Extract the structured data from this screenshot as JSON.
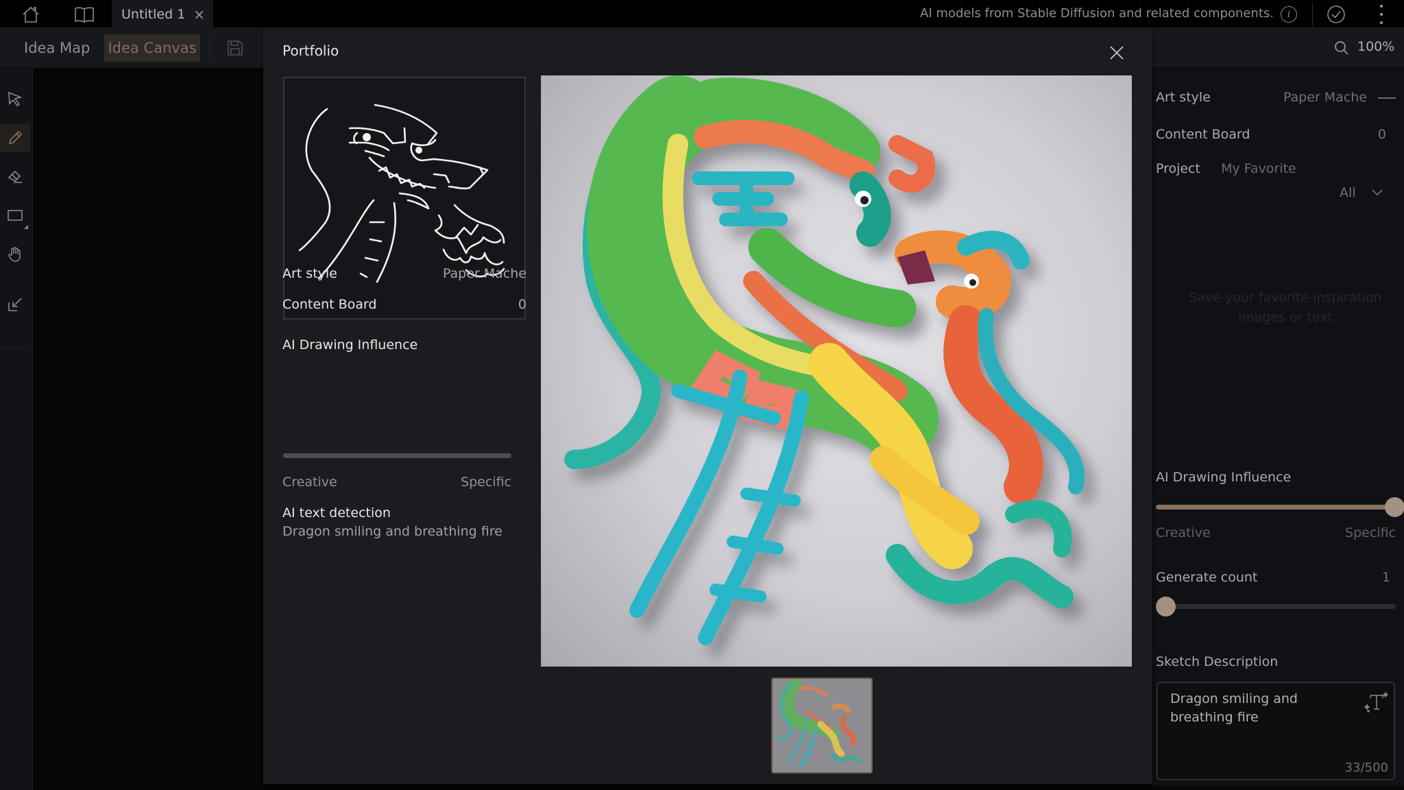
{
  "titlebar": {
    "home_icon": "home-icon",
    "book_icon": "book-icon",
    "tab_title": "Untitled 1",
    "tab_close": "×",
    "notice": "AI models from Stable Diffusion and related components.",
    "info_icon": "i",
    "check_icon": "check-circle-icon",
    "menu_icon": "kebab-menu-icon"
  },
  "toolbar": {
    "mode_idea_map": "Idea Map",
    "mode_idea_canvas": "Idea Canvas",
    "save_icon": "save-icon",
    "zoom_level": "100%"
  },
  "tools": [
    {
      "name": "select",
      "icon": "cursor-arrow-icon",
      "active": false
    },
    {
      "name": "pencil",
      "icon": "pencil-icon",
      "active": true
    },
    {
      "name": "eraser",
      "icon": "eraser-icon",
      "active": false
    },
    {
      "name": "rectangle",
      "icon": "rectangle-icon",
      "active": false
    },
    {
      "name": "hand",
      "icon": "hand-icon",
      "active": false
    },
    {
      "name": "import",
      "icon": "import-arrow-icon",
      "active": false
    }
  ],
  "modal": {
    "title": "Portfolio",
    "close_icon": "close-icon",
    "art_style_label": "Art style",
    "art_style_value": "Paper Mache",
    "content_board_label": "Content Board",
    "content_board_value": "0",
    "influence_label": "AI Drawing Influence",
    "influence_min": "Creative",
    "influence_max": "Specific",
    "text_detection_label": "AI text detection",
    "text_detection_value": "Dragon smiling and breathing fire",
    "main_image_alt": "Generated paper mache dragon",
    "thumbnails": [
      {
        "alt": "Generated paper mache dragon thumbnail",
        "selected": true
      }
    ]
  },
  "right_panel": {
    "art_style_label": "Art style",
    "art_style_value": "Paper Mache",
    "content_board_label": "Content Board",
    "content_board_value": "0",
    "project_label": "Project",
    "project_value": "My Favorite",
    "filter_value": "All",
    "empty_state": "Save your favorite inspiration images or text",
    "influence_label": "AI Drawing Influence",
    "influence_min": "Creative",
    "influence_max": "Specific",
    "influence_value": 1.0,
    "generate_count_label": "Generate count",
    "generate_count_value": "1",
    "generate_count_fraction": 0.0,
    "sketch_description_label": "Sketch Description",
    "sketch_description_value": "Dragon smiling and breathing fire",
    "char_count": "33/500"
  },
  "colors": {
    "accent": "#a39280",
    "accent_fill": "#8a7459",
    "modal_bg": "#1a1c1f",
    "panel_bg": "#0f1114"
  }
}
